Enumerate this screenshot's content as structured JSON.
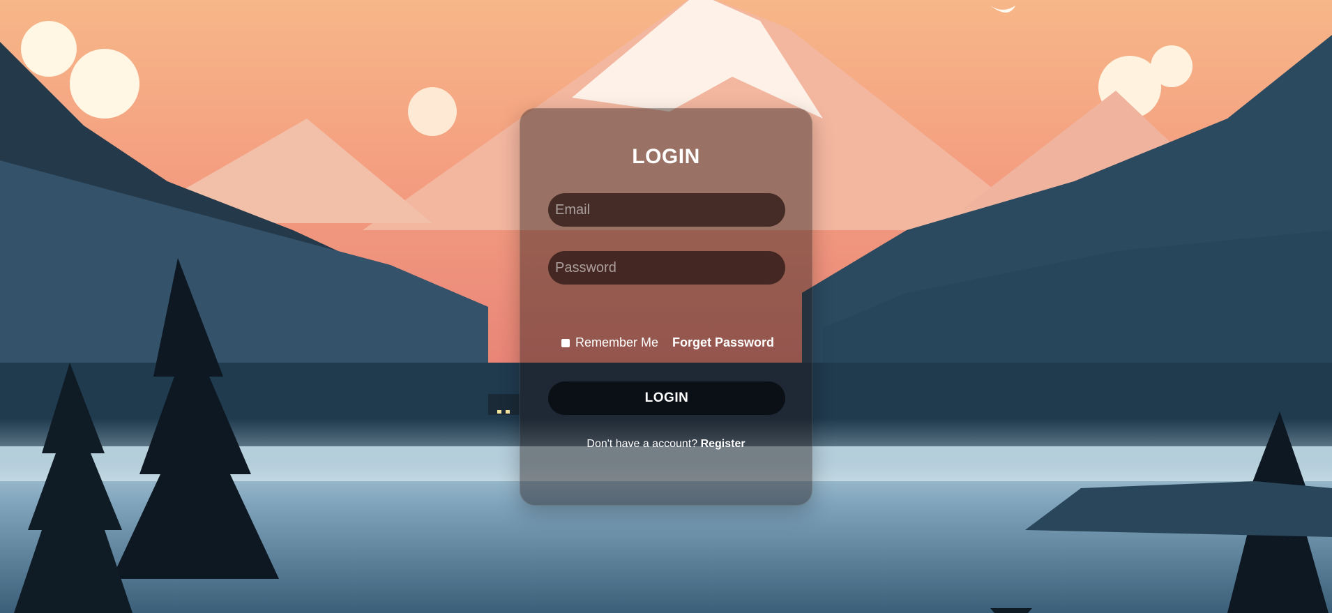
{
  "login": {
    "title": "LOGIN",
    "email_placeholder": "Email",
    "password_placeholder": "Password",
    "remember_label": "Remember Me",
    "forgot_label": "Forget Password",
    "submit_label": "LOGIN",
    "no_account_text": "Don't have a account?",
    "register_label": "Register"
  },
  "colors": {
    "sky_top": "#f6b483",
    "mountain_snow": "#fdf0e6",
    "forest_dark": "#1e3345",
    "lake": "#8fb2c7",
    "card_bg": "rgba(30,20,20,0.42)"
  }
}
